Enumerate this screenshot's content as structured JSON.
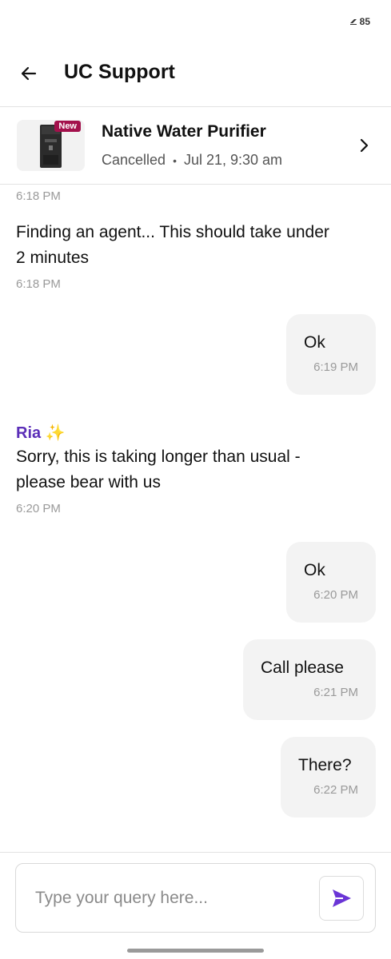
{
  "status_bar": {
    "battery": "85"
  },
  "header": {
    "title": "UC Support"
  },
  "order": {
    "badge": "New",
    "name": "Native Water Purifier",
    "status": "Cancelled",
    "separator": "•",
    "datetime": "Jul 21, 9:30 am"
  },
  "messages": {
    "top_time": "6:18 PM",
    "m1": {
      "text": "Finding an agent... This should take under 2 minutes",
      "time": "6:18 PM"
    },
    "m2": {
      "text": "Ok",
      "time": "6:19 PM"
    },
    "m3": {
      "sender": "Ria ✨",
      "text": "Sorry, this is taking longer than usual - please bear with us",
      "time": "6:20 PM"
    },
    "m4": {
      "text": "Ok",
      "time": "6:20 PM"
    },
    "m5": {
      "text": "Call please",
      "time": "6:21 PM"
    },
    "m6": {
      "text": "There?",
      "time": "6:22 PM"
    }
  },
  "composer": {
    "placeholder": "Type your query here..."
  },
  "colors": {
    "accent": "#5b2eb8",
    "badge": "#a3114c",
    "bubble": "#f3f3f3",
    "send": "#6a35d6"
  },
  "icons": {
    "back": "arrow-left-icon",
    "chevron": "chevron-right-icon",
    "send": "send-icon",
    "battery": "battery-icon"
  }
}
